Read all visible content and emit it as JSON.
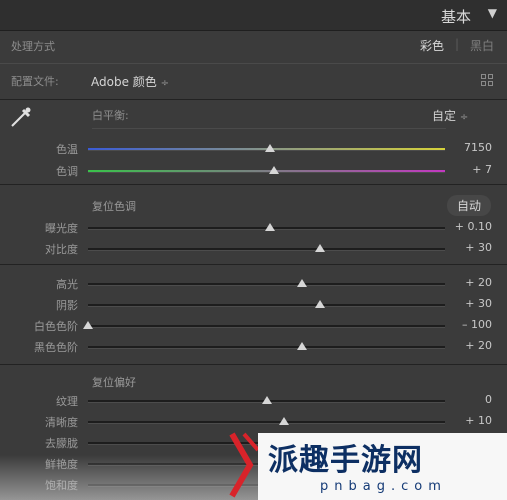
{
  "header": {
    "title": "基本",
    "collapse_icon": "triangle-down-icon"
  },
  "treatment": {
    "label": "处理方式",
    "color": "彩色",
    "separator": "|",
    "bw": "黑白"
  },
  "profile": {
    "label": "配置文件:",
    "value": "Adobe 颜色",
    "value_arrow": "÷",
    "browse_icon": "grid-icon"
  },
  "wb": {
    "picker_icon": "eyedropper-icon",
    "label": "白平衡:",
    "value": "自定",
    "value_arrow": "÷"
  },
  "sliders_wb": [
    {
      "label": "色温",
      "value": "7150",
      "pos": 0.51
    },
    {
      "label": "色调",
      "value": "+ 7",
      "pos": 0.52
    }
  ],
  "tone": {
    "reset_label": "复位色调",
    "auto_label": "自动"
  },
  "sliders_tone": [
    {
      "label": "曝光度",
      "value": "+ 0.10",
      "pos": 0.51
    },
    {
      "label": "对比度",
      "value": "+ 30",
      "pos": 0.65
    }
  ],
  "sliders_tone2": [
    {
      "label": "高光",
      "value": "+ 20",
      "pos": 0.6
    },
    {
      "label": "阴影",
      "value": "+ 30",
      "pos": 0.65
    },
    {
      "label": "白色色阶",
      "value": "– 100",
      "pos": 0.0
    },
    {
      "label": "黑色色阶",
      "value": "+ 20",
      "pos": 0.6
    }
  ],
  "presence": {
    "reset_label": "复位偏好"
  },
  "sliders_presence": [
    {
      "label": "纹理",
      "value": "0",
      "pos": 0.5
    },
    {
      "label": "清晰度",
      "value": "+ 10",
      "pos": 0.55
    },
    {
      "label": "去朦胧",
      "value": "",
      "pos": 0.5
    },
    {
      "label": "鲜艳度",
      "value": "",
      "pos": 0.5
    },
    {
      "label": "饱和度",
      "value": "",
      "pos": 0.5
    }
  ],
  "watermark": {
    "title": "派趣手游网",
    "subtitle": "pnbag.com"
  },
  "colors": {
    "temp_left": "#3a5bd6",
    "temp_right": "#d6d23a",
    "tint_left": "#39c24a",
    "tint_right": "#c238c0"
  }
}
